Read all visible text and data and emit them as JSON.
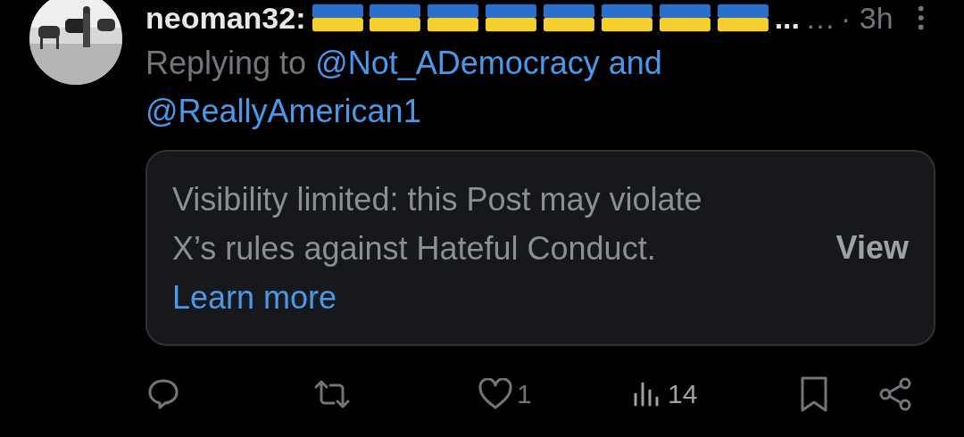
{
  "post": {
    "author": "neoman32:",
    "name_emoji": [
      {
        "kind": "flag_ua"
      },
      {
        "kind": "flag_ua"
      },
      {
        "kind": "flag_ua"
      },
      {
        "kind": "flag_ua"
      },
      {
        "kind": "flag_ua"
      },
      {
        "kind": "flag_ua"
      },
      {
        "kind": "flag_ua"
      },
      {
        "kind": "flag_ua"
      }
    ],
    "name_cut": "...",
    "overflow": "…",
    "time": "· 3h",
    "replying_prefix": "Replying to",
    "replying_to": [
      "@Not_ADemocracy",
      "@ReallyAmerican1"
    ],
    "replying_join": "and",
    "notice": {
      "text": "Visibility limited: this Post may violate X’s rules against Hateful Conduct.",
      "link": "Learn more",
      "button": "View"
    },
    "actions": [
      {
        "kind": "reply"
      },
      {
        "kind": "repost"
      },
      {
        "kind": "like",
        "count": "1"
      },
      {
        "kind": "views",
        "count": "14"
      },
      {
        "kind": "bookmark"
      },
      {
        "kind": "share"
      }
    ]
  }
}
